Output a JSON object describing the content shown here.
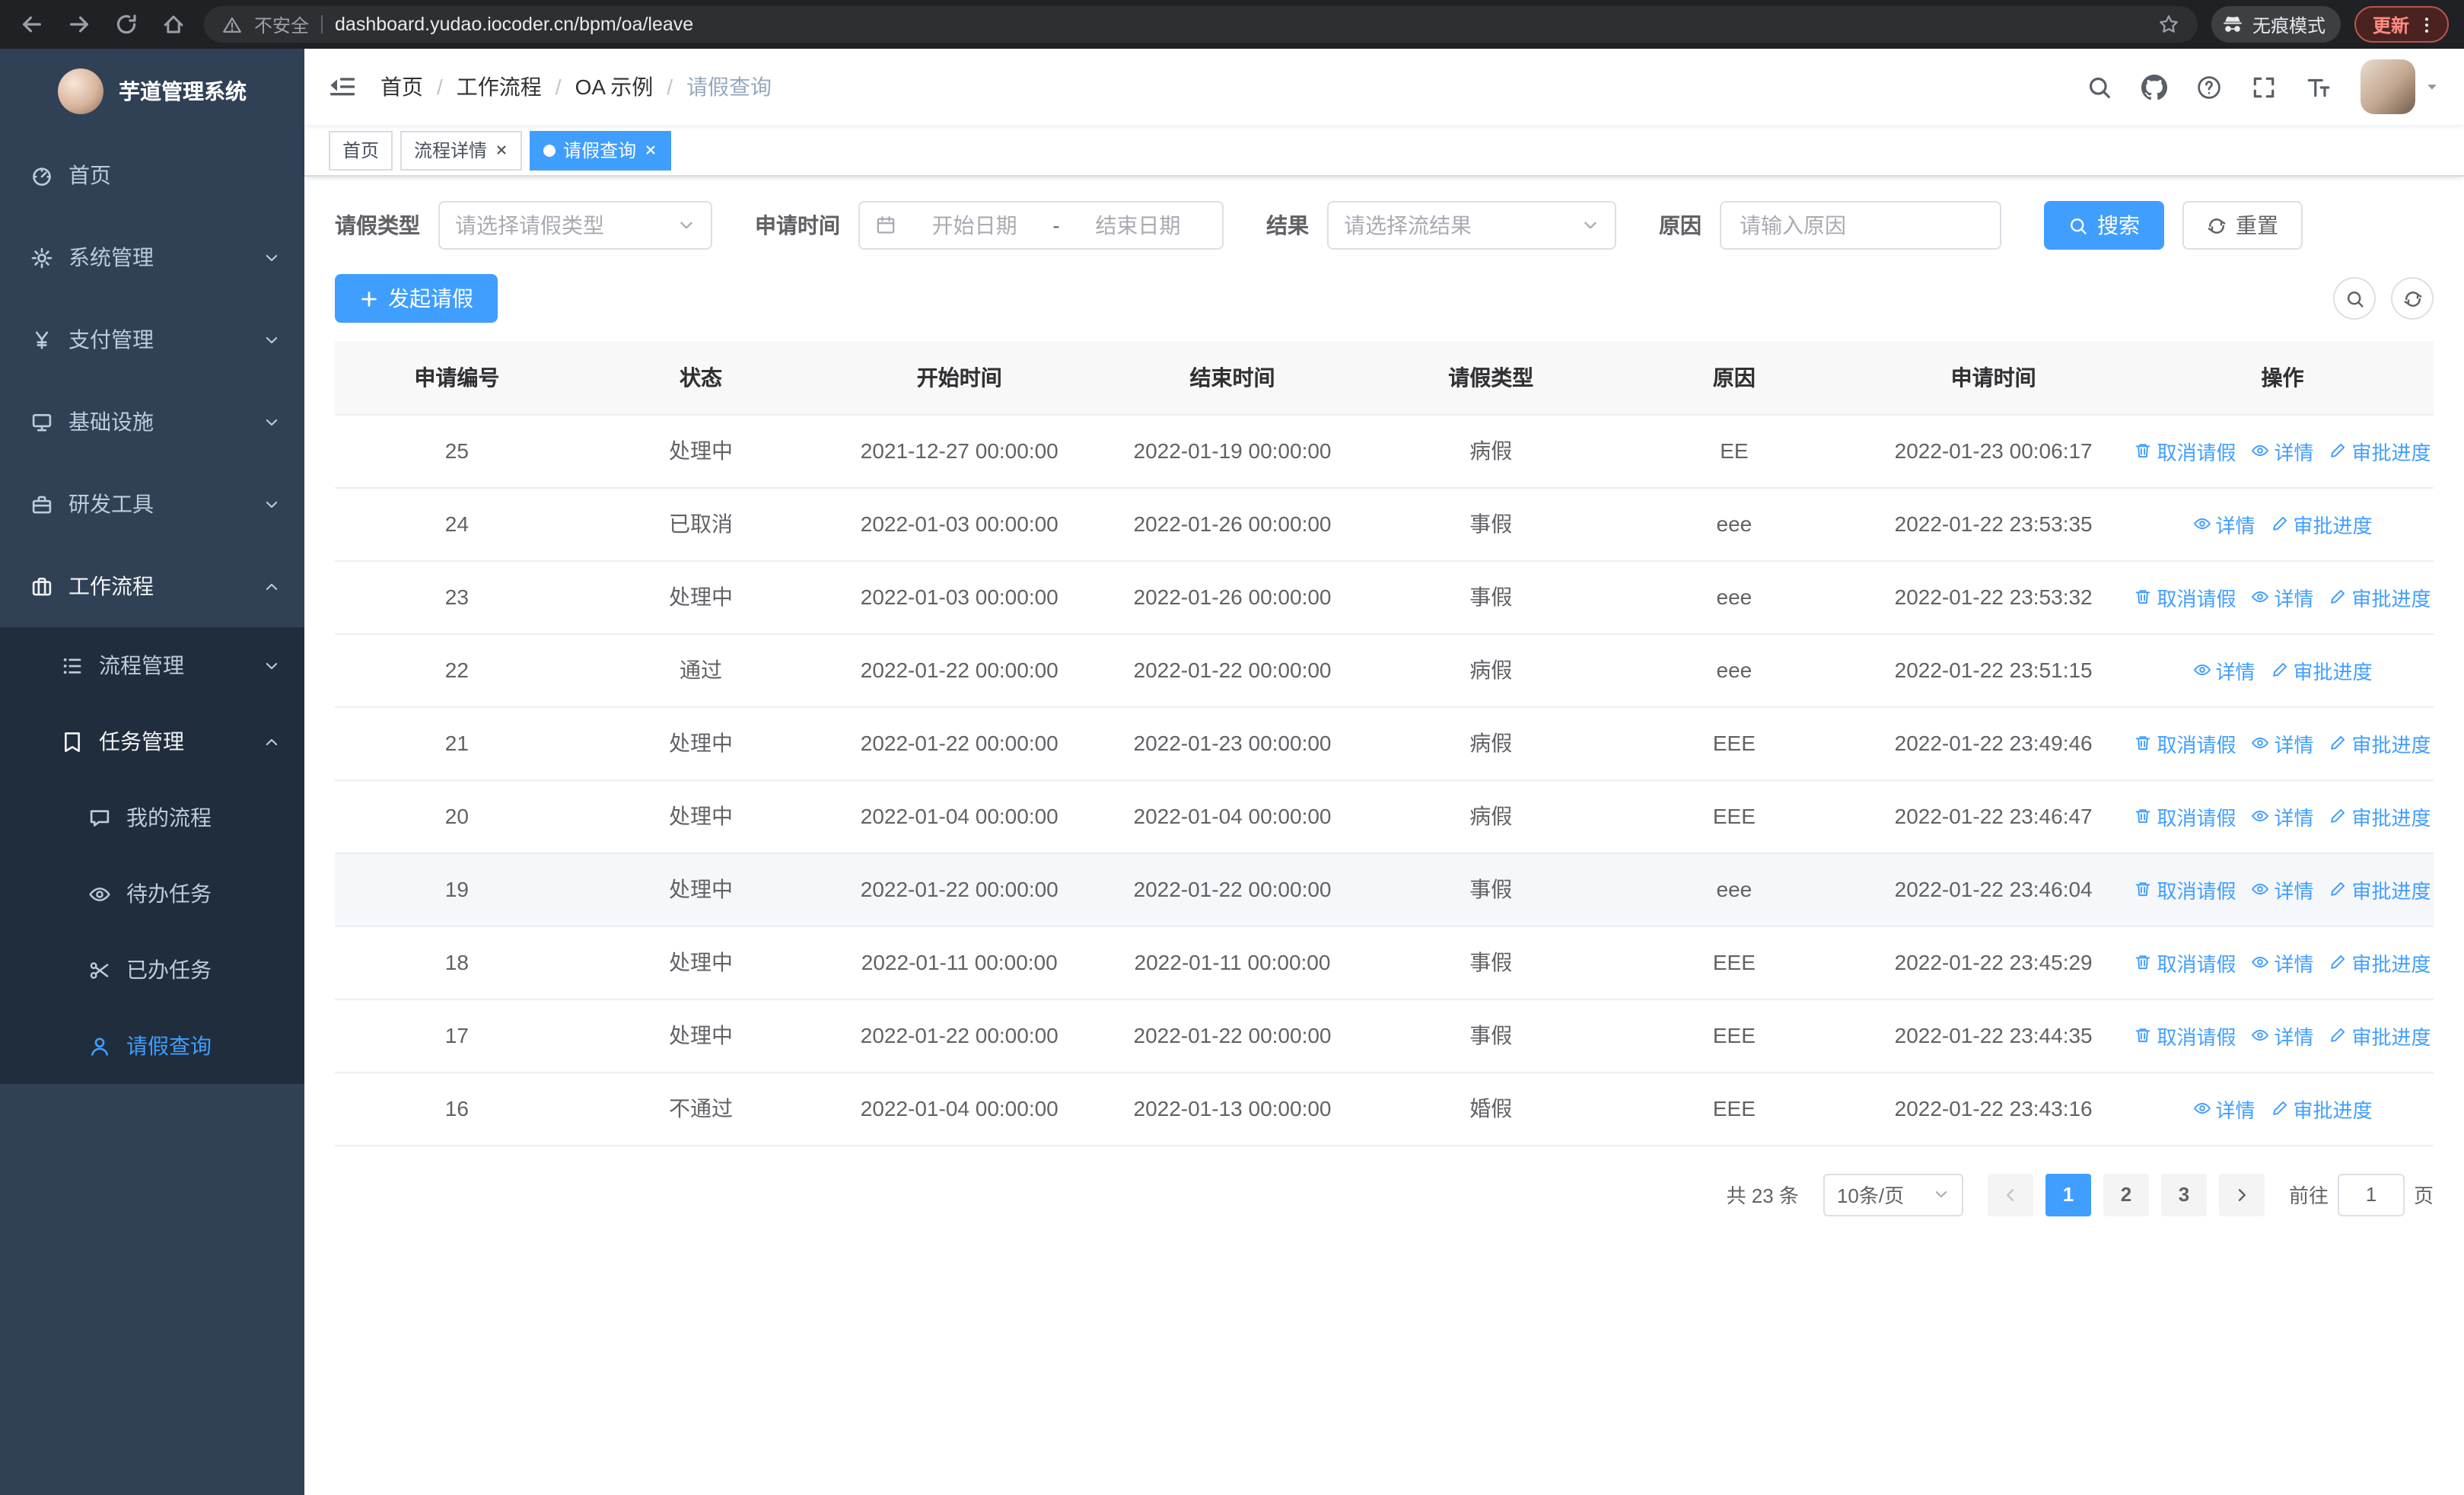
{
  "browser": {
    "security_label": "不安全",
    "url": "dashboard.yudao.iocoder.cn/bpm/oa/leave",
    "incognito_label": "无痕模式",
    "update_label": "更新"
  },
  "app": {
    "title": "芋道管理系统"
  },
  "sidebar": {
    "menu": [
      {
        "key": "home",
        "label": "首页",
        "icon": "dashboard-icon",
        "level": 1
      },
      {
        "key": "system-management",
        "label": "系统管理",
        "icon": "gear-icon",
        "level": 1,
        "chevron": "down"
      },
      {
        "key": "payment-management",
        "label": "支付管理",
        "icon": "yen-icon",
        "level": 1,
        "chevron": "down"
      },
      {
        "key": "infrastructure",
        "label": "基础设施",
        "icon": "infrastructure-icon",
        "level": 1,
        "chevron": "down"
      },
      {
        "key": "dev-tools",
        "label": "研发工具",
        "icon": "tools-icon",
        "level": 1,
        "chevron": "down"
      },
      {
        "key": "workflow",
        "label": "工作流程",
        "icon": "briefcase-icon",
        "level": 1,
        "chevron": "up",
        "trail": true
      },
      {
        "key": "process-management",
        "label": "流程管理",
        "icon": "process-icon",
        "level": 2,
        "chevron": "down",
        "sub": true
      },
      {
        "key": "task-management",
        "label": "任务管理",
        "icon": "task-icon",
        "level": 2,
        "chevron": "up",
        "sub": true,
        "trail": true
      },
      {
        "key": "my-processes",
        "label": "我的流程",
        "icon": "chat-icon",
        "level": 3,
        "sub": true
      },
      {
        "key": "todo-tasks",
        "label": "待办任务",
        "icon": "eye-icon",
        "level": 3,
        "sub": true
      },
      {
        "key": "done-tasks",
        "label": "已办任务",
        "icon": "scissors-icon",
        "level": 3,
        "sub": true
      },
      {
        "key": "leave-query",
        "label": "请假查询",
        "icon": "user-icon",
        "level": 3,
        "sub": true,
        "active": true
      }
    ]
  },
  "breadcrumb": {
    "items": [
      "首页",
      "工作流程",
      "OA 示例",
      "请假查询"
    ]
  },
  "tabs": [
    {
      "key": "home",
      "label": "首页",
      "closable": false,
      "active": false
    },
    {
      "key": "process-detail",
      "label": "流程详情",
      "closable": true,
      "active": false
    },
    {
      "key": "leave-query",
      "label": "请假查询",
      "closable": true,
      "active": true
    }
  ],
  "filters": {
    "leave_type": {
      "label": "请假类型",
      "placeholder": "请选择请假类型"
    },
    "apply_time": {
      "label": "申请时间",
      "start_placeholder": "开始日期",
      "separator": "-",
      "end_placeholder": "结束日期"
    },
    "result": {
      "label": "结果",
      "placeholder": "请选择流结果"
    },
    "reason": {
      "label": "原因",
      "placeholder": "请输入原因"
    },
    "search_label": "搜索",
    "reset_label": "重置"
  },
  "toolbar": {
    "create_label": "发起请假"
  },
  "table": {
    "columns": [
      "申请编号",
      "状态",
      "开始时间",
      "结束时间",
      "请假类型",
      "原因",
      "申请时间",
      "操作"
    ],
    "action_defs": {
      "cancel": {
        "label": "取消请假",
        "icon": "trash-icon"
      },
      "detail": {
        "label": "详情",
        "icon": "eye-icon"
      },
      "progress": {
        "label": "审批进度",
        "icon": "edit-icon"
      }
    },
    "rows": [
      {
        "id": "25",
        "status": "处理中",
        "start_time": "2021-12-27 00:00:00",
        "end_time": "2022-01-19 00:00:00",
        "leave_type": "病假",
        "reason": "EE",
        "apply_time": "2022-01-23 00:06:17",
        "actions": [
          "cancel",
          "detail",
          "progress"
        ]
      },
      {
        "id": "24",
        "status": "已取消",
        "start_time": "2022-01-03 00:00:00",
        "end_time": "2022-01-26 00:00:00",
        "leave_type": "事假",
        "reason": "eee",
        "apply_time": "2022-01-22 23:53:35",
        "actions": [
          "detail",
          "progress"
        ]
      },
      {
        "id": "23",
        "status": "处理中",
        "start_time": "2022-01-03 00:00:00",
        "end_time": "2022-01-26 00:00:00",
        "leave_type": "事假",
        "reason": "eee",
        "apply_time": "2022-01-22 23:53:32",
        "actions": [
          "cancel",
          "detail",
          "progress"
        ]
      },
      {
        "id": "22",
        "status": "通过",
        "start_time": "2022-01-22 00:00:00",
        "end_time": "2022-01-22 00:00:00",
        "leave_type": "病假",
        "reason": "eee",
        "apply_time": "2022-01-22 23:51:15",
        "actions": [
          "detail",
          "progress"
        ]
      },
      {
        "id": "21",
        "status": "处理中",
        "start_time": "2022-01-22 00:00:00",
        "end_time": "2022-01-23 00:00:00",
        "leave_type": "病假",
        "reason": "EEE",
        "apply_time": "2022-01-22 23:49:46",
        "actions": [
          "cancel",
          "detail",
          "progress"
        ]
      },
      {
        "id": "20",
        "status": "处理中",
        "start_time": "2022-01-04 00:00:00",
        "end_time": "2022-01-04 00:00:00",
        "leave_type": "病假",
        "reason": "EEE",
        "apply_time": "2022-01-22 23:46:47",
        "actions": [
          "cancel",
          "detail",
          "progress"
        ]
      },
      {
        "id": "19",
        "status": "处理中",
        "start_time": "2022-01-22 00:00:00",
        "end_time": "2022-01-22 00:00:00",
        "leave_type": "事假",
        "reason": "eee",
        "apply_time": "2022-01-22 23:46:04",
        "actions": [
          "cancel",
          "detail",
          "progress"
        ],
        "hover": true
      },
      {
        "id": "18",
        "status": "处理中",
        "start_time": "2022-01-11 00:00:00",
        "end_time": "2022-01-11 00:00:00",
        "leave_type": "事假",
        "reason": "EEE",
        "apply_time": "2022-01-22 23:45:29",
        "actions": [
          "cancel",
          "detail",
          "progress"
        ]
      },
      {
        "id": "17",
        "status": "处理中",
        "start_time": "2022-01-22 00:00:00",
        "end_time": "2022-01-22 00:00:00",
        "leave_type": "事假",
        "reason": "EEE",
        "apply_time": "2022-01-22 23:44:35",
        "actions": [
          "cancel",
          "detail",
          "progress"
        ]
      },
      {
        "id": "16",
        "status": "不通过",
        "start_time": "2022-01-04 00:00:00",
        "end_time": "2022-01-13 00:00:00",
        "leave_type": "婚假",
        "reason": "EEE",
        "apply_time": "2022-01-22 23:43:16",
        "actions": [
          "detail",
          "progress"
        ]
      }
    ]
  },
  "pagination": {
    "total_label": "共 23 条",
    "page_size_label": "10条/页",
    "pages": [
      "1",
      "2",
      "3"
    ],
    "active_page": "1",
    "goto_label": "前往",
    "goto_value": "1",
    "goto_suffix": "页"
  },
  "colors": {
    "accent": "#409eff",
    "sidebar_bg": "#304156",
    "submenu_bg": "#1f2d3d"
  }
}
